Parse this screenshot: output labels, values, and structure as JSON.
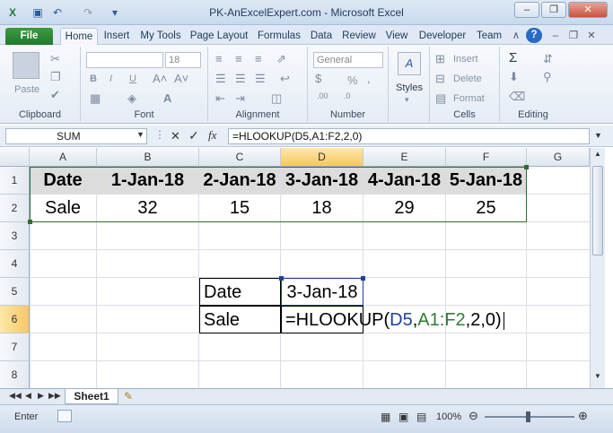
{
  "window": {
    "title": "PK-AnExcelExpert.com - Microsoft Excel",
    "controls": [
      "minimize",
      "restore",
      "close"
    ]
  },
  "quick_access": {
    "icons": [
      "excel-logo-icon",
      "save-icon",
      "undo-icon",
      "redo-icon",
      "customize-icon"
    ]
  },
  "tabs": [
    "File",
    "Home",
    "Insert",
    "My Tools",
    "Page Layout",
    "Formulas",
    "Data",
    "Review",
    "View",
    "Developer",
    "Team"
  ],
  "ribbon": {
    "clipboard": {
      "paste": "Paste",
      "label": "Clipboard"
    },
    "font": {
      "size": "18",
      "label": "Font",
      "bold": "B",
      "italic": "I",
      "underline": "U"
    },
    "alignment": {
      "label": "Alignment"
    },
    "number": {
      "format": "General",
      "percent": "%",
      "label": "Number"
    },
    "styles": {
      "label": "Styles"
    },
    "cells": {
      "insert": "Insert",
      "delete": "Delete",
      "format": "Format",
      "label": "Cells"
    },
    "editing": {
      "label": "Editing"
    }
  },
  "formula_bar": {
    "name_box": "SUM",
    "cancel": "✕",
    "enter": "✓",
    "fx": "fx",
    "formula": "=HLOOKUP(D5,A1:F2,2,0)"
  },
  "columns": [
    "A",
    "B",
    "C",
    "D",
    "E",
    "F",
    "G"
  ],
  "rows": [
    "1",
    "2",
    "3",
    "4",
    "5",
    "6",
    "7",
    "8"
  ],
  "cells": {
    "A1": "Date",
    "B1": "1-Jan-18",
    "C1": "2-Jan-18",
    "D1": "3-Jan-18",
    "E1": "4-Jan-18",
    "F1": "5-Jan-18",
    "A2": "Sale",
    "B2": "32",
    "C2": "15",
    "D2": "18",
    "E2": "29",
    "F2": "25",
    "C5": "Date",
    "D5": "3-Jan-18",
    "C6": "Sale",
    "D6_parts": {
      "prefix": "=HLOOKUP(",
      "ref1": "D5",
      "comma1": ",",
      "ref2": "A1:F2",
      "suffix": ",2,0)"
    }
  },
  "colors": {
    "ref1": "#1f3f9b",
    "ref2": "#2e7d32",
    "selection_border": "#2f6e2f",
    "file_tab": "#2b8a3e"
  },
  "sheet_tabs": [
    "Sheet1"
  ],
  "status": {
    "mode": "Enter",
    "zoom": "100%"
  }
}
